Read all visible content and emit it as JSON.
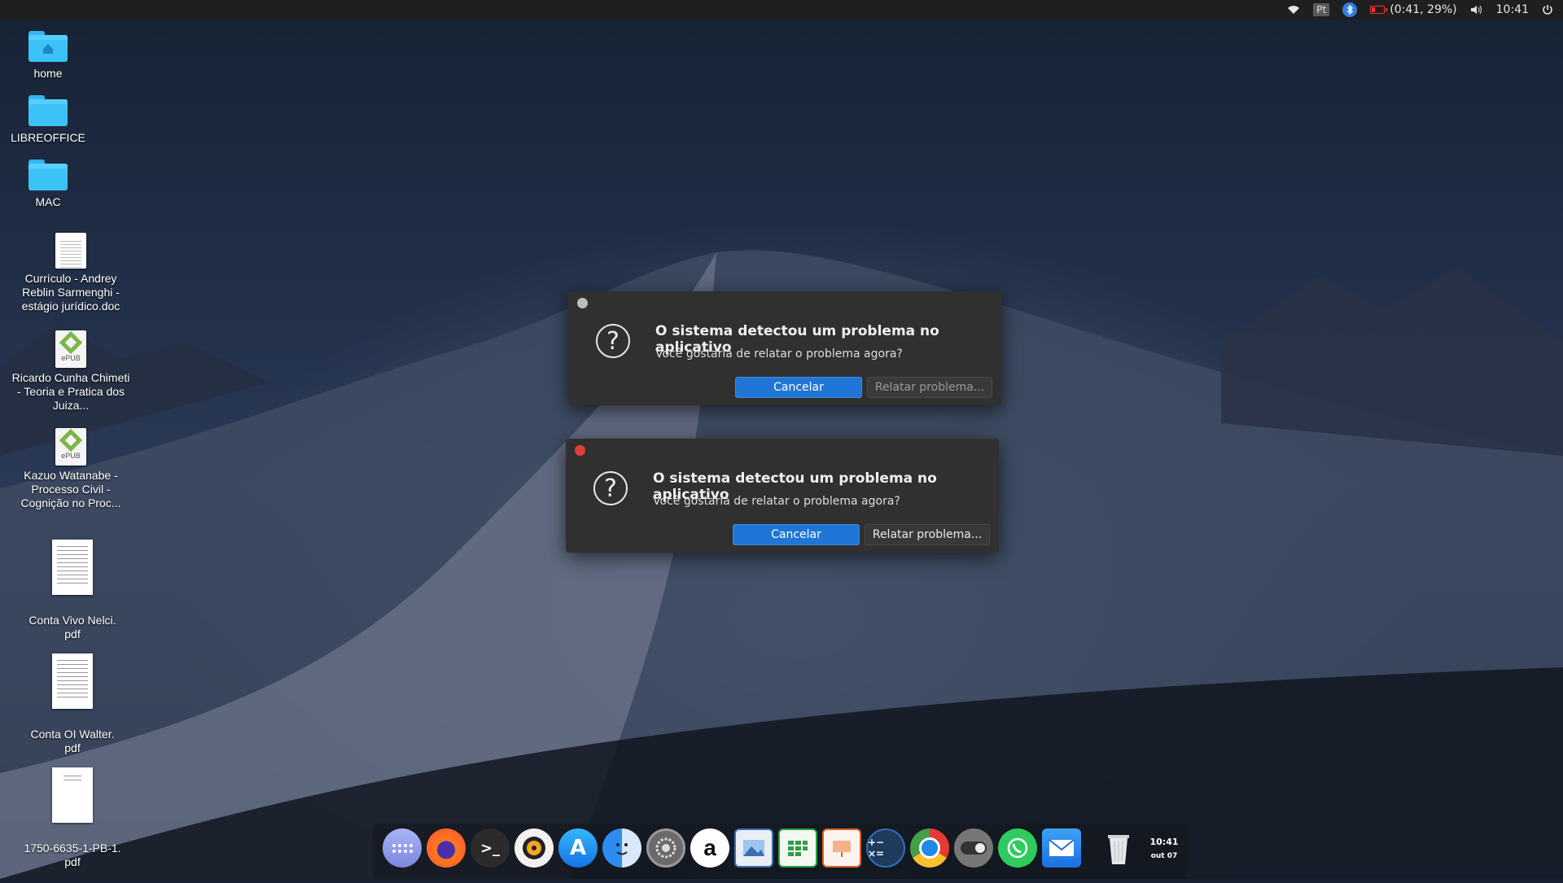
{
  "topbar": {
    "keyboard_layout": "Pt",
    "battery_text": "(0:41, 29%)",
    "clock": "10:41"
  },
  "desktop_icons": [
    {
      "label": "home",
      "type": "folder-home"
    },
    {
      "label": "LIBREOFFICE",
      "type": "folder"
    },
    {
      "label": "MAC",
      "type": "folder"
    },
    {
      "label": "Currículo - Andrey Reblin Sarmenghi - estágio jurídico.doc",
      "type": "doc"
    },
    {
      "label": "Ricardo Cunha Chimeti - Teoria e Pratica dos Juiza...",
      "type": "epub"
    },
    {
      "label": "Kazuo Watanabe - Processo Civil - Cognição no Proc...",
      "type": "epub"
    },
    {
      "label": "Conta Vivo Nelci.\npdf",
      "type": "pdf"
    },
    {
      "label": "Conta OI Walter.\npdf",
      "type": "pdf"
    },
    {
      "label": "1750-6635-1-PB-1.\npdf",
      "type": "pdf"
    }
  ],
  "epub_badge": "ePUB",
  "dialogs": [
    {
      "title": "O sistema detectou um problema no aplicativo",
      "message": "Você gostaria de relatar o problema agora?",
      "cancel_label": "Cancelar",
      "report_label": "Relatar problema...",
      "state": "inactive",
      "dot_color": "#bdbdbd"
    },
    {
      "title": "O sistema detectou um problema no aplicativo",
      "message": "Você gostaria de relatar o problema agora?",
      "cancel_label": "Cancelar",
      "report_label": "Relatar problema...",
      "state": "active",
      "dot_color": "#e0403a"
    }
  ],
  "dock": {
    "apps": [
      "launchpad-icon",
      "firefox-icon",
      "terminal-icon",
      "rhythmbox-icon",
      "app-store-icon",
      "finder-icon",
      "system-settings-icon",
      "amazon-icon",
      "image-viewer-icon",
      "spreadsheet-icon",
      "presentation-icon",
      "calculator-icon",
      "chrome-icon",
      "toggle-settings-icon",
      "whatsapp-icon",
      "mail-icon",
      "trash-icon"
    ],
    "clock_time": "10:41",
    "clock_date": "out 07"
  },
  "colors": {
    "accent_blue": "#1f76d6",
    "dialog_bg": "#303030",
    "topbar_bg": "#1f1f1f",
    "folder_blue": "#3cc2f7"
  }
}
